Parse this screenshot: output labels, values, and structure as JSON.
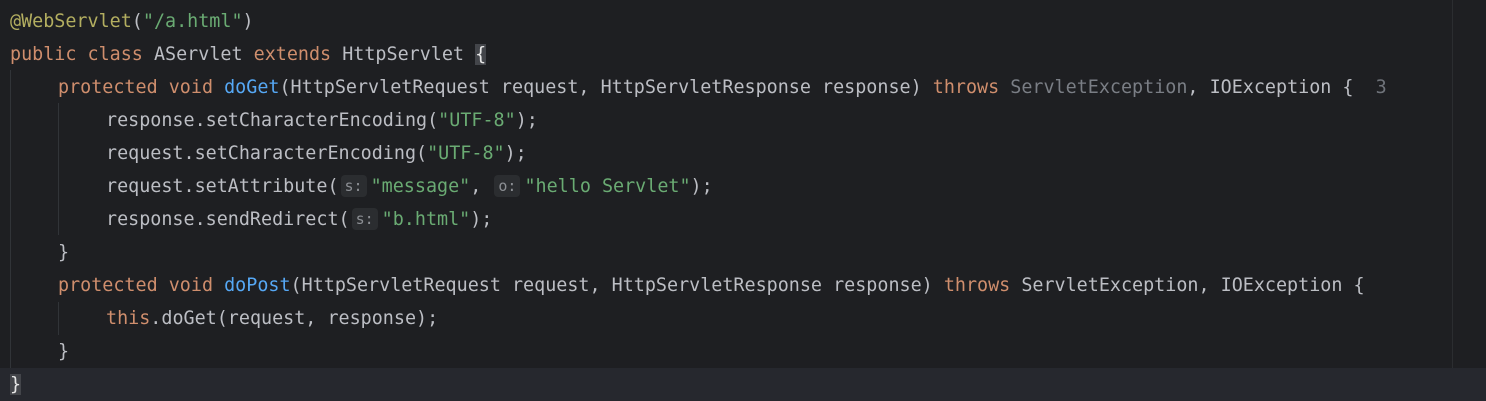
{
  "editor": {
    "lines": [
      {
        "tokens": [
          {
            "t": "@WebServlet",
            "c": "annotation"
          },
          {
            "t": "(",
            "c": ""
          },
          {
            "t": "\"/a.html\"",
            "c": "str"
          },
          {
            "t": ")",
            "c": ""
          }
        ]
      },
      {
        "tokens": [
          {
            "t": "public",
            "c": "kw"
          },
          {
            "t": " ",
            "c": ""
          },
          {
            "t": "class",
            "c": "kw"
          },
          {
            "t": " AServlet ",
            "c": ""
          },
          {
            "t": "extends",
            "c": "kw"
          },
          {
            "t": " HttpServlet ",
            "c": ""
          },
          {
            "t": "{",
            "c": "brace-match"
          }
        ]
      },
      {
        "tokens": [
          {
            "t": "protected",
            "c": "kw"
          },
          {
            "t": " ",
            "c": ""
          },
          {
            "t": "void",
            "c": "kw"
          },
          {
            "t": " ",
            "c": ""
          },
          {
            "t": "doGet",
            "c": "fn"
          },
          {
            "t": "(HttpServletRequest request, HttpServletResponse response) ",
            "c": ""
          },
          {
            "t": "throws",
            "c": "kw"
          },
          {
            "t": " ",
            "c": ""
          },
          {
            "t": "ServletException",
            "c": "deprecatedish"
          },
          {
            "t": ", IOException {  ",
            "c": ""
          },
          {
            "t": "3",
            "c": "gutter-overflow"
          }
        ]
      },
      {
        "tokens": [
          {
            "t": "response.setCharacterEncoding(",
            "c": ""
          },
          {
            "t": "\"UTF-8\"",
            "c": "str"
          },
          {
            "t": ");",
            "c": ""
          }
        ]
      },
      {
        "tokens": [
          {
            "t": "request.setCharacterEncoding(",
            "c": ""
          },
          {
            "t": "\"UTF-8\"",
            "c": "str"
          },
          {
            "t": ");",
            "c": ""
          }
        ]
      },
      {
        "tokens": [
          {
            "t": "request.setAttribute(",
            "c": ""
          },
          {
            "t": "s:",
            "c": "hint"
          },
          {
            "t": "\"message\"",
            "c": "str"
          },
          {
            "t": ", ",
            "c": ""
          },
          {
            "t": "o:",
            "c": "hint"
          },
          {
            "t": "\"hello Servlet\"",
            "c": "str"
          },
          {
            "t": ");",
            "c": ""
          }
        ]
      },
      {
        "tokens": [
          {
            "t": "response.sendRedirect(",
            "c": ""
          },
          {
            "t": "s:",
            "c": "hint"
          },
          {
            "t": "\"b.html\"",
            "c": "str"
          },
          {
            "t": ");",
            "c": ""
          }
        ]
      },
      {
        "tokens": [
          {
            "t": "}",
            "c": ""
          }
        ]
      },
      {
        "tokens": [
          {
            "t": "protected",
            "c": "kw"
          },
          {
            "t": " ",
            "c": ""
          },
          {
            "t": "void",
            "c": "kw"
          },
          {
            "t": " ",
            "c": ""
          },
          {
            "t": "doPost",
            "c": "fn"
          },
          {
            "t": "(HttpServletRequest request, HttpServletResponse response) ",
            "c": ""
          },
          {
            "t": "throws",
            "c": "kw"
          },
          {
            "t": " ServletException, IOException {",
            "c": ""
          }
        ]
      },
      {
        "tokens": [
          {
            "t": "this",
            "c": "kw"
          },
          {
            "t": ".doGet(request, response);",
            "c": ""
          }
        ]
      },
      {
        "tokens": [
          {
            "t": "}",
            "c": ""
          }
        ]
      },
      {
        "tokens": [
          {
            "t": "}",
            "c": "brace-match"
          }
        ]
      }
    ]
  }
}
